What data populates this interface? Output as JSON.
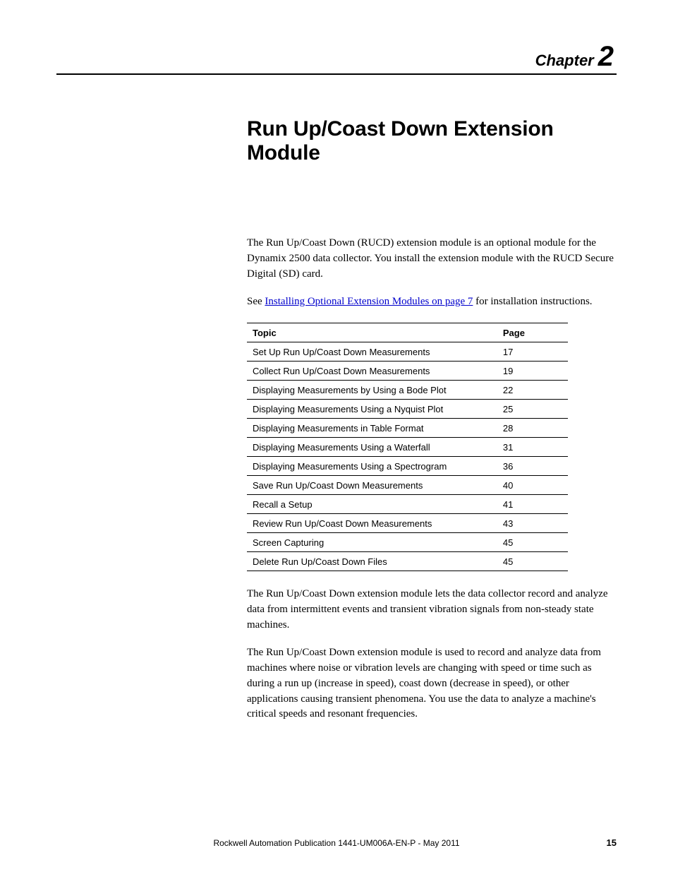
{
  "chapter": {
    "label_word": "Chapter",
    "label_number": "2"
  },
  "title": "Run Up/Coast Down Extension Module",
  "intro_1": "The Run Up/Coast Down (RUCD) extension module is an optional module for the Dynamix 2500 data collector. You install the extension module with the RUCD Secure Digital (SD) card.",
  "see_prefix": "See ",
  "see_link": "Installing Optional Extension Modules on page 7",
  "see_suffix": " for installation instructions.",
  "table": {
    "headers": {
      "topic": "Topic",
      "page": "Page"
    },
    "rows": [
      {
        "topic": "Set Up Run Up/Coast Down Measurements",
        "page": "17"
      },
      {
        "topic": "Collect Run Up/Coast Down Measurements",
        "page": "19"
      },
      {
        "topic": "Displaying Measurements by Using a Bode Plot",
        "page": "22"
      },
      {
        "topic": "Displaying Measurements Using a Nyquist Plot",
        "page": "25"
      },
      {
        "topic": "Displaying Measurements in Table Format",
        "page": "28"
      },
      {
        "topic": "Displaying Measurements Using a Waterfall",
        "page": "31"
      },
      {
        "topic": "Displaying Measurements Using a Spectrogram",
        "page": "36"
      },
      {
        "topic": "Save Run Up/Coast Down Measurements",
        "page": "40"
      },
      {
        "topic": "Recall a Setup",
        "page": "41"
      },
      {
        "topic": "Review Run Up/Coast Down Measurements",
        "page": "43"
      },
      {
        "topic": "Screen Capturing",
        "page": "45"
      },
      {
        "topic": "Delete Run Up/Coast Down Files",
        "page": "45"
      }
    ]
  },
  "para_2": "The Run Up/Coast Down extension module lets the data collector record and analyze data from intermittent events and transient vibration signals from non-steady state machines.",
  "para_3": "The Run Up/Coast Down extension module is used to record and analyze data from machines where noise or vibration levels are changing with speed or time such as during a run up (increase in speed), coast down (decrease in speed), or other applications causing transient phenomena. You use the data to analyze a machine's critical speeds and resonant frequencies.",
  "footer": {
    "pubinfo": "Rockwell Automation Publication 1441-UM006A-EN-P - May 2011",
    "pagenum": "15"
  }
}
